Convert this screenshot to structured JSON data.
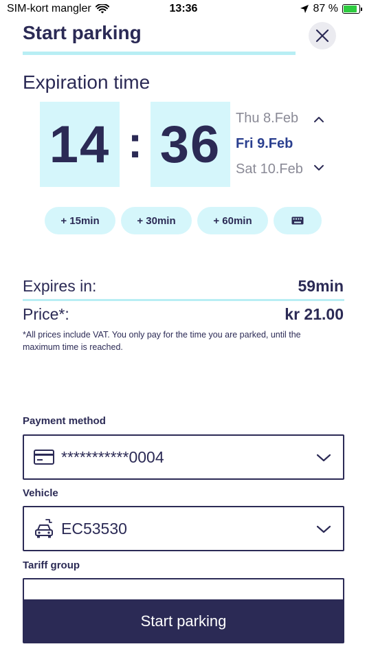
{
  "status_bar": {
    "carrier": "SIM-kort mangler",
    "time": "13:36",
    "battery": "87 %",
    "battery_level": 0.87,
    "icons": [
      "wifi-icon",
      "location-arrow-icon",
      "battery-charging-icon"
    ]
  },
  "header": {
    "title": "Start parking",
    "close_icon": "close-icon"
  },
  "expiration": {
    "title": "Expiration time",
    "hours": "14",
    "separator": ":",
    "minutes": "36",
    "dates": {
      "previous": "Thu 8.Feb",
      "selected": "Fri 9.Feb",
      "next": "Sat 10.Feb"
    },
    "quick_add": [
      "+ 15min",
      "+ 30min",
      "+ 60min"
    ],
    "keyboard_icon": "keyboard-icon"
  },
  "summary": {
    "expires_label": "Expires in:",
    "expires_value": "59min",
    "price_label": "Price*:",
    "price_value": "kr 21.00",
    "vat_note": "*All prices include VAT. You only pay for the time you are parked, until the maximum time is reached."
  },
  "payment": {
    "label": "Payment method",
    "value": "***********0004",
    "icon": "credit-card-icon"
  },
  "vehicle": {
    "label": "Vehicle",
    "value": "EC53530",
    "icon": "electric-car-icon"
  },
  "tariff": {
    "label": "Tariff group"
  },
  "actions": {
    "start_label": "Start parking"
  },
  "colors": {
    "primary": "#2b2a55",
    "accent_light": "#d5f6fb",
    "accent_line": "#b8eef4",
    "date_selected": "#2a3f8f",
    "muted": "#8a8a96"
  }
}
